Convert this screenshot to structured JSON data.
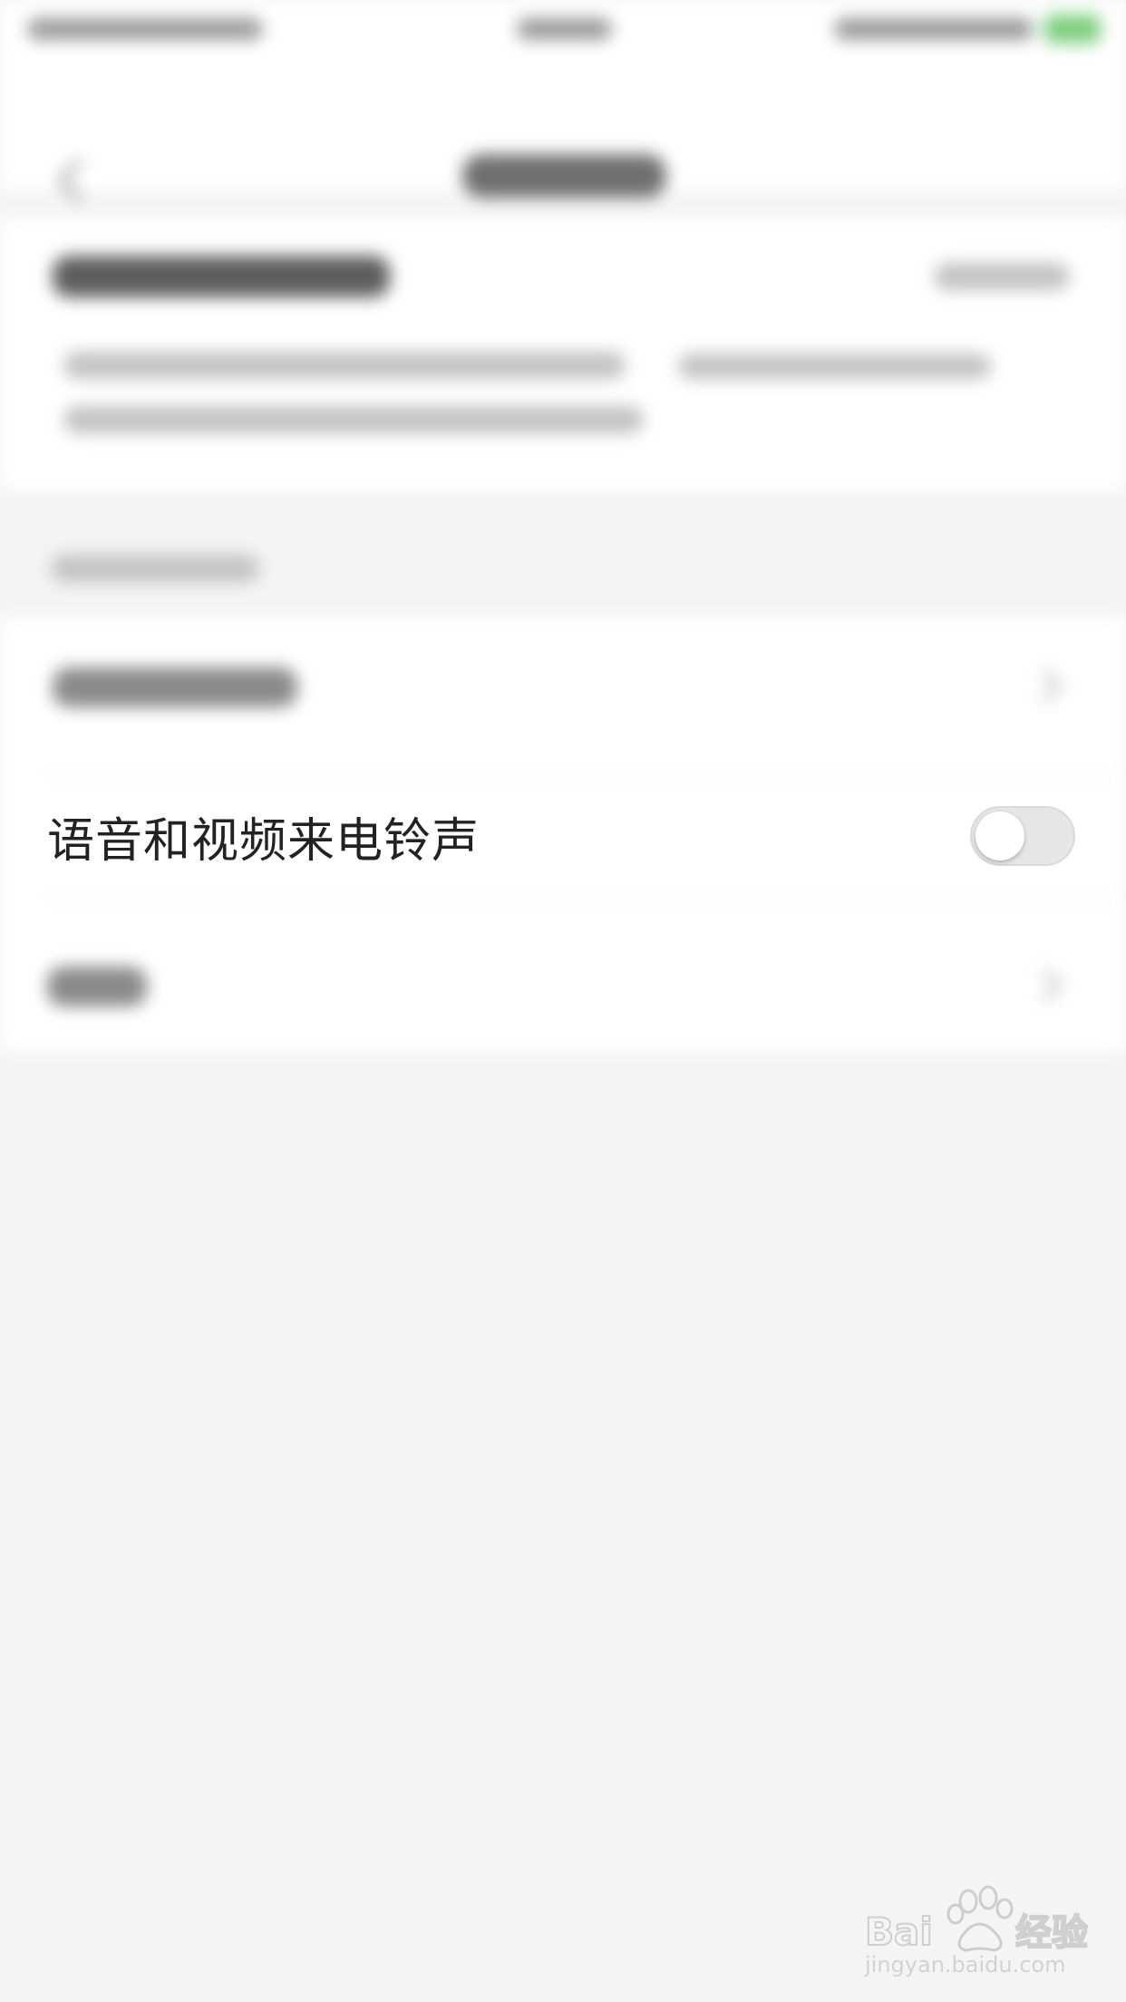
{
  "settings_row": {
    "label": "语音和视频来电铃声",
    "toggle_on": false
  },
  "watermark": {
    "brand": "Baidu经验",
    "url": "jingyan.baidu.com"
  },
  "colors": {
    "background": "#f4f4f4",
    "card": "#ffffff",
    "text": "#222222",
    "toggle_off_track": "#e6e6e6",
    "battery_accent": "#7dd07d"
  }
}
